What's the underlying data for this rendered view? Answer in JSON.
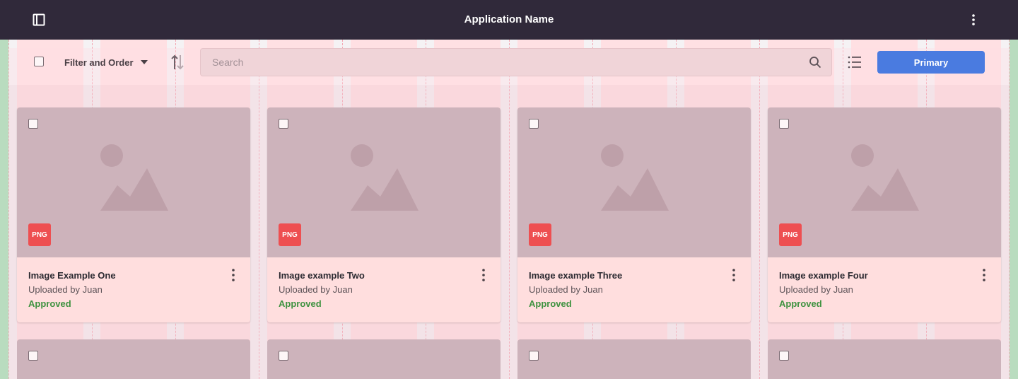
{
  "topbar": {
    "title": "Application Name",
    "sidebar_icon": "sidebar-toggle-icon",
    "menu_icon": "more-vertical-icon",
    "background": "#30293a"
  },
  "toolbar": {
    "filter_label": "Filter and Order",
    "search_placeholder": "Search",
    "primary_label": "Primary",
    "primary_color": "#4a7be0"
  },
  "cards": [
    {
      "title": "Image Example One",
      "subtitle": "Uploaded by Juan",
      "status": "Approved",
      "badge": "PNG"
    },
    {
      "title": "Image example Two",
      "subtitle": "Uploaded by Juan",
      "status": "Approved",
      "badge": "PNG"
    },
    {
      "title": "Image example Three",
      "subtitle": "Uploaded by Juan",
      "status": "Approved",
      "badge": "PNG"
    },
    {
      "title": "Image example Four",
      "subtitle": "Uploaded by Juan",
      "status": "Approved",
      "badge": "PNG"
    }
  ],
  "colors": {
    "badge": "#ee4f51",
    "status_approved": "#3f9240"
  }
}
